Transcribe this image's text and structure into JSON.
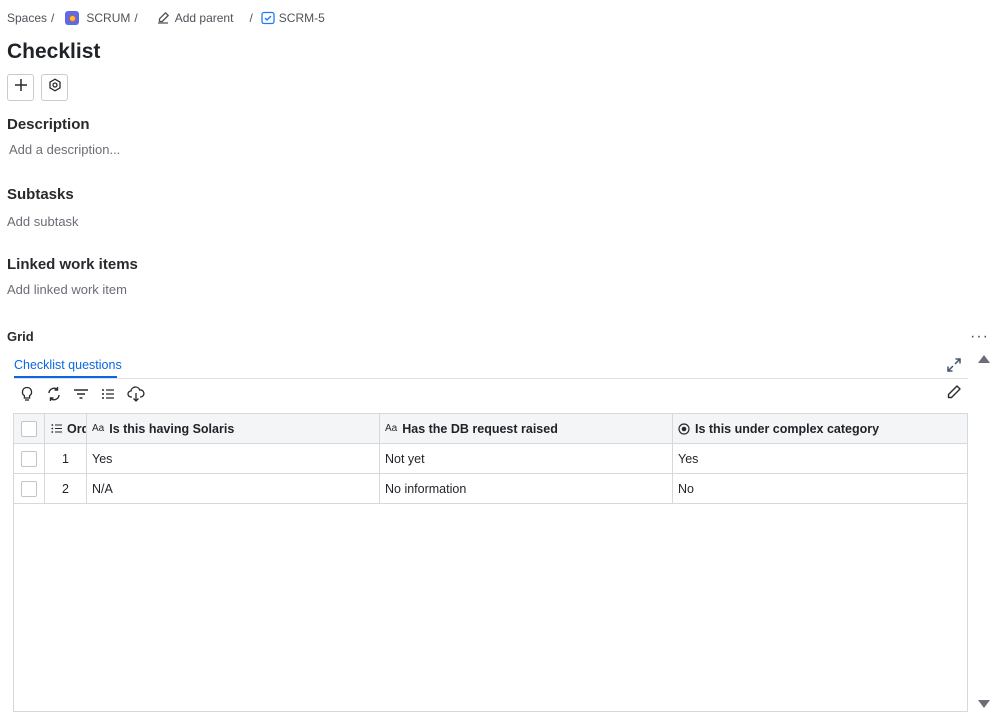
{
  "breadcrumb": {
    "spaces": "Spaces",
    "project": "SCRUM",
    "add_parent": "Add parent",
    "issue_key": "SCRM-5",
    "separator": "/"
  },
  "page": {
    "title": "Checklist"
  },
  "description": {
    "title": "Description",
    "placeholder": "Add a description..."
  },
  "subtasks": {
    "title": "Subtasks",
    "placeholder": "Add subtask"
  },
  "linked": {
    "title": "Linked work items",
    "placeholder": "Add linked work item"
  },
  "grid": {
    "title": "Grid",
    "more": "···",
    "tab": "Checklist questions",
    "columns": {
      "order": "Ord",
      "q1_type": "Aa",
      "q1": "Is this having Solaris",
      "q2_type": "Aa",
      "q2": "Has the DB request raised",
      "q3": "Is this under complex category"
    },
    "rows": [
      {
        "order": "1",
        "q1": "Yes",
        "q2": "Not yet",
        "q3": "Yes"
      },
      {
        "order": "2",
        "q1": "N/A",
        "q2": "No information",
        "q3": "No"
      }
    ]
  },
  "colors": {
    "accent": "#0c66e4",
    "text": "#292a2e",
    "muted": "#6b6e76"
  }
}
